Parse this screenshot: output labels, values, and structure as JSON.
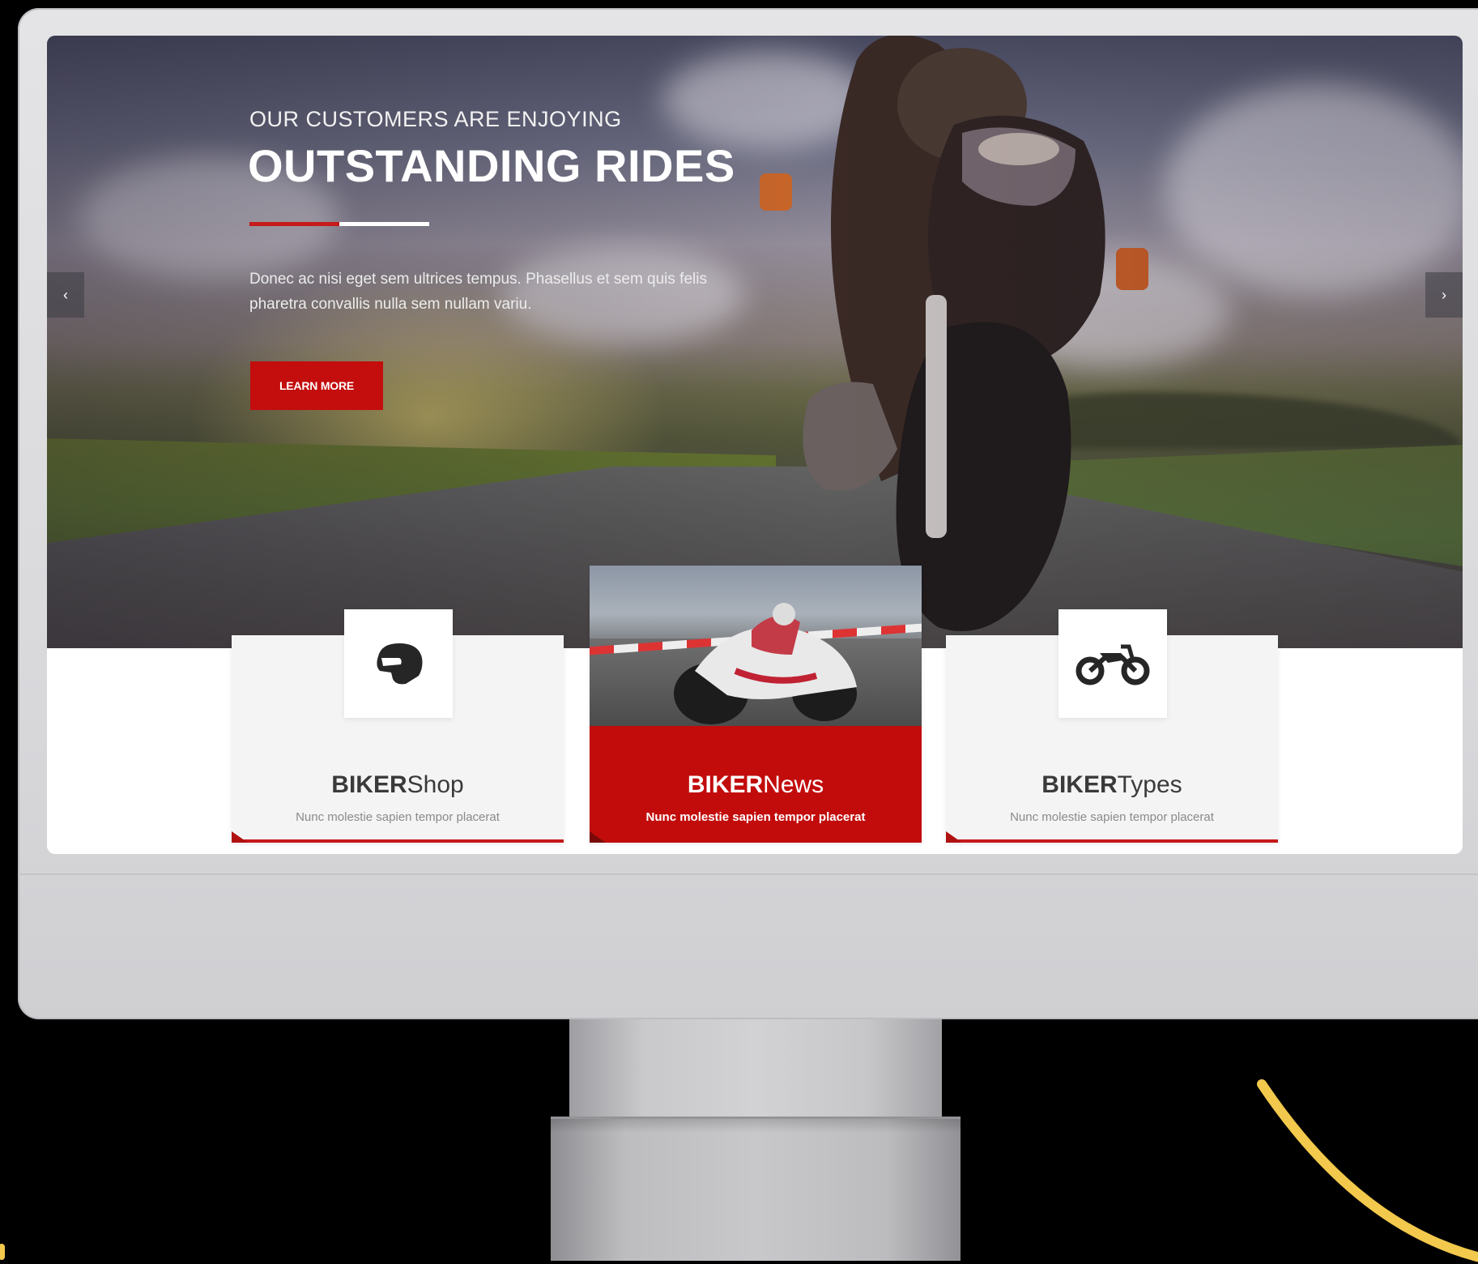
{
  "hero": {
    "overline": "OUR CUSTOMERS ARE ENJOYING",
    "title": "OUTSTANDING RIDES",
    "description": "Donec ac nisi eget sem ultrices tempus. Phasellus et sem quis felis pharetra convallis nulla sem nullam variu.",
    "cta_label": "LEARN MORE",
    "prev_arrow": "‹",
    "next_arrow": "›"
  },
  "features": [
    {
      "title_bold": "BIKER",
      "title_light": "Shop",
      "subtitle": "Nunc molestie sapien tempor placerat",
      "icon": "helmet-icon"
    },
    {
      "title_bold": "BIKER",
      "title_light": "News",
      "subtitle": "Nunc molestie sapien tempor placerat",
      "icon": "motorcycle-photo"
    },
    {
      "title_bold": "BIKER",
      "title_light": "Types",
      "subtitle": "Nunc molestie sapien tempor placerat",
      "icon": "motorbike-icon"
    }
  ],
  "colors": {
    "accent": "#c40d0d",
    "card_bg": "#f4f4f4",
    "text_dark": "#3a3a3a",
    "decor_yellow": "#f2c94c"
  }
}
